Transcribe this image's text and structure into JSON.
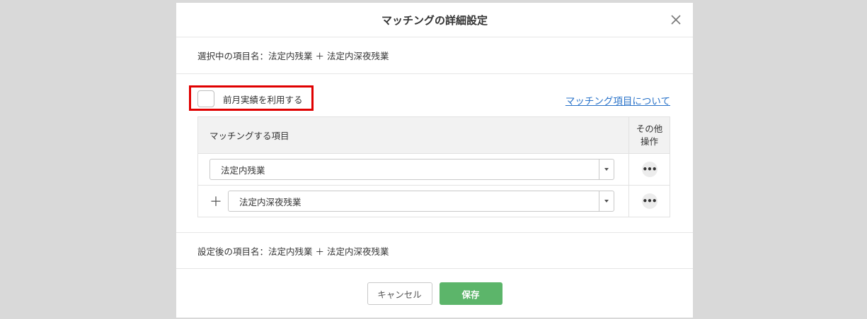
{
  "modal": {
    "title": "マッチングの詳細設定",
    "selected_item_label": "選択中の項目名：法定内残業 ＋ 法定内深夜残業",
    "use_previous_month_label": "前月実績を利用する",
    "use_previous_month_checked": false,
    "help_link": "マッチング項目について",
    "table": {
      "header_item": "マッチングする項目",
      "header_ops": "その他\n操作",
      "rows": [
        {
          "prefix": "",
          "value": "法定内残業",
          "ops": "•••"
        },
        {
          "prefix": "＋",
          "value": "法定内深夜残業",
          "ops": "•••"
        }
      ]
    },
    "after_item_label": "設定後の項目名：法定内残業 ＋ 法定内深夜残業",
    "cancel_label": "キャンセル",
    "save_label": "保存"
  },
  "colors": {
    "save_button": "#5cb56a",
    "link": "#2a73c9",
    "highlight": "#e00000",
    "backdrop": "#d9d9d9"
  }
}
